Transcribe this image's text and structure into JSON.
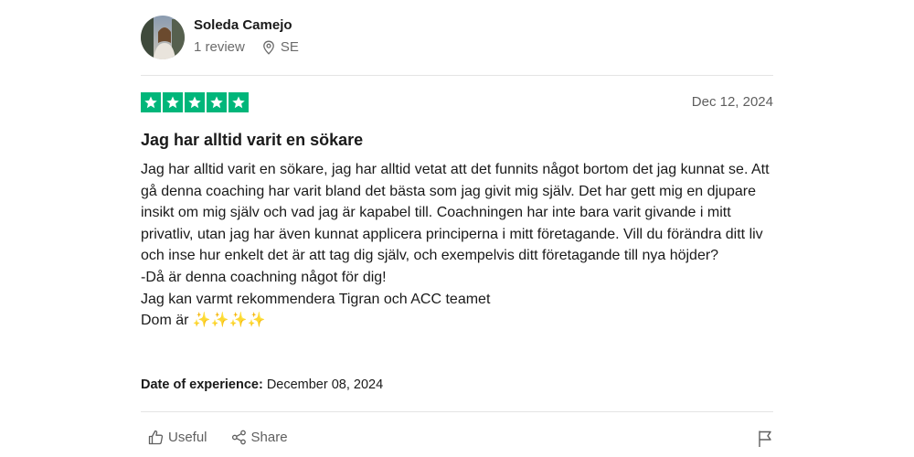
{
  "reviewer": {
    "name": "Soleda Camejo",
    "review_count": "1 review",
    "country": "SE"
  },
  "review": {
    "rating": 5,
    "date": "Dec 12, 2024",
    "title": "Jag har alltid varit en sökare",
    "paragraph": "Jag har alltid varit en sökare, jag har alltid vetat att det funnits något bortom det jag kunnat se. Att gå denna coaching har varit bland det bästa som jag givit mig själv. Det har gett mig en djupare insikt om mig själv och vad jag är kapabel till. Coachningen har inte bara varit givande i mitt privatliv, utan jag har även kunnat applicera principerna i mitt företagande. Vill du förändra ditt liv och inse hur enkelt det är att tag dig själv, och exempelvis ditt företagande till nya höjder?",
    "line2": "-Då är denna coachning något för dig!",
    "line3": "Jag kan varmt rekommendera Tigran och ACC teamet",
    "line4_prefix": "Dom är ",
    "line4_emoji": "✨✨✨✨",
    "experience_label": "Date of experience:",
    "experience_date": "December 08, 2024"
  },
  "actions": {
    "useful_label": "Useful",
    "share_label": "Share"
  },
  "colors": {
    "star_green": "#00b67a",
    "text_primary": "#1a1a1a",
    "text_secondary": "#6b6b6b",
    "divider": "#e4e4e4"
  },
  "icons": [
    "avatar",
    "location-pin-icon",
    "star-icon",
    "thumbs-up-icon",
    "share-icon",
    "flag-icon"
  ]
}
